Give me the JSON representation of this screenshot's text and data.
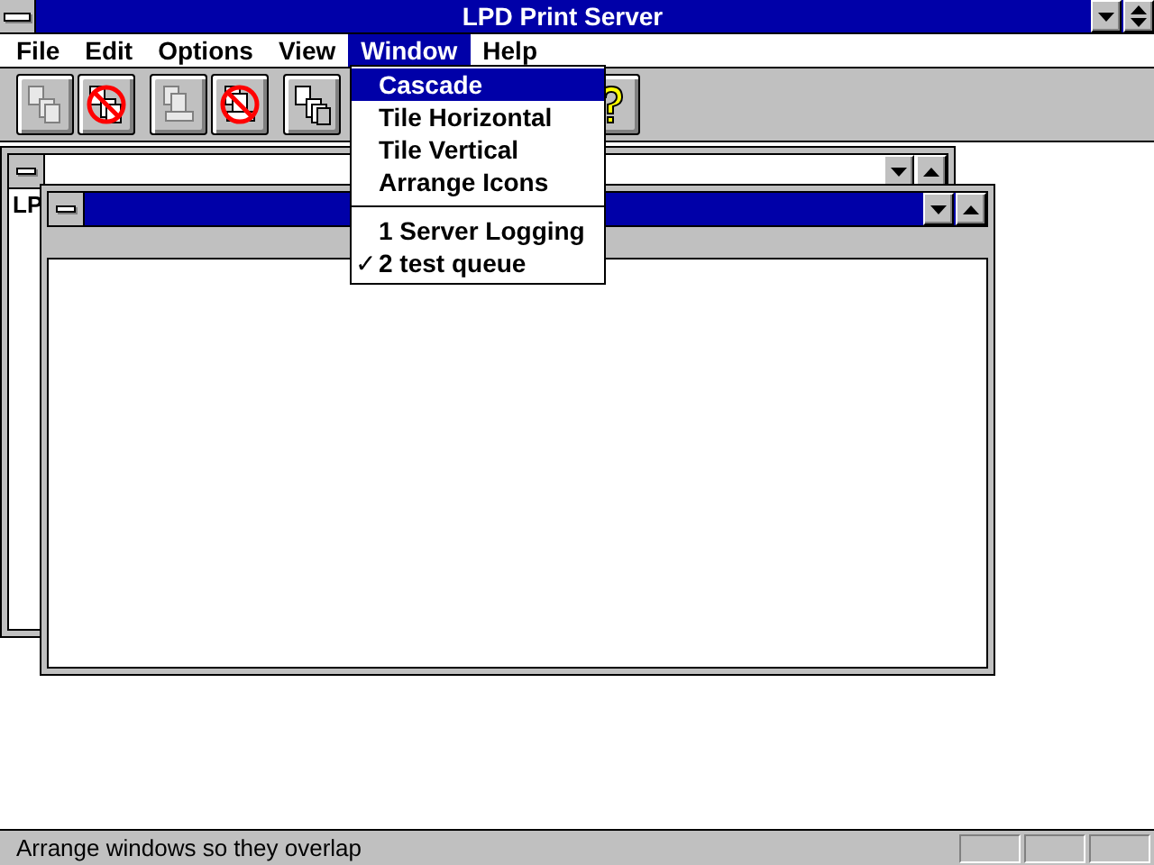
{
  "window": {
    "title": "LPD Print Server"
  },
  "menu": [
    {
      "label": "File",
      "selected": false
    },
    {
      "label": "Edit",
      "selected": false
    },
    {
      "label": "Options",
      "selected": false
    },
    {
      "label": "View",
      "selected": false
    },
    {
      "label": "Window",
      "selected": true
    },
    {
      "label": "Help",
      "selected": false
    }
  ],
  "toolbar": [
    {
      "kind": "copy",
      "disabled": true
    },
    {
      "kind": "nocopy",
      "disabled": false
    },
    {
      "kind": "print",
      "disabled": true
    },
    {
      "kind": "noprint",
      "disabled": false
    },
    {
      "kind": "delete",
      "disabled": false
    },
    {
      "kind": "help",
      "disabled": false
    }
  ],
  "window_menu": {
    "items": [
      {
        "label": "Cascade",
        "selected": true,
        "checked": false
      },
      {
        "label": "Tile Horizontal",
        "selected": false,
        "checked": false
      },
      {
        "label": "Tile Vertical",
        "selected": false,
        "checked": false
      },
      {
        "label": "Arrange Icons",
        "selected": false,
        "checked": false
      },
      {
        "kind": "separator"
      },
      {
        "label": "1 Server Logging",
        "selected": false,
        "checked": false
      },
      {
        "label": "2 test queue",
        "selected": false,
        "checked": true
      }
    ],
    "check": "✓"
  },
  "child_windows": [
    {
      "active": false,
      "content": "LP"
    },
    {
      "active": true
    }
  ],
  "status_bar": {
    "text": "Arrange windows so they overlap"
  }
}
